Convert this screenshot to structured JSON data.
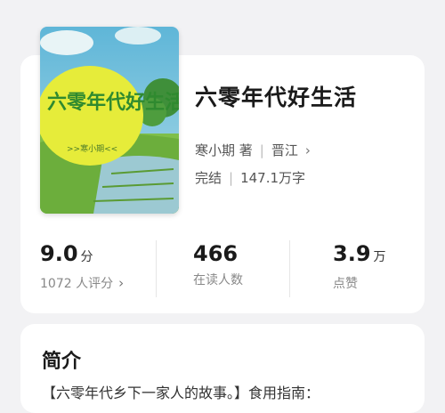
{
  "book": {
    "cover_title": "六零年代好生活",
    "cover_author": ">>寒小期<<",
    "title": "六零年代好生活",
    "author": "寒小期 著",
    "platform": "晋江",
    "status": "完结",
    "word_count": "147.1万字"
  },
  "stats": [
    {
      "value": "9.0",
      "unit": "分",
      "label": "1072 人评分"
    },
    {
      "value": "466",
      "unit": "",
      "label": "在读人数"
    },
    {
      "value": "3.9",
      "unit": "万",
      "label": "点赞"
    }
  ],
  "intro": {
    "heading": "简介",
    "text": "【六零年代乡下一家人的故事。】食用指南："
  },
  "icons": {
    "platform_chevron": "chevron-right-icon",
    "rating_chevron": "chevron-right-icon"
  }
}
